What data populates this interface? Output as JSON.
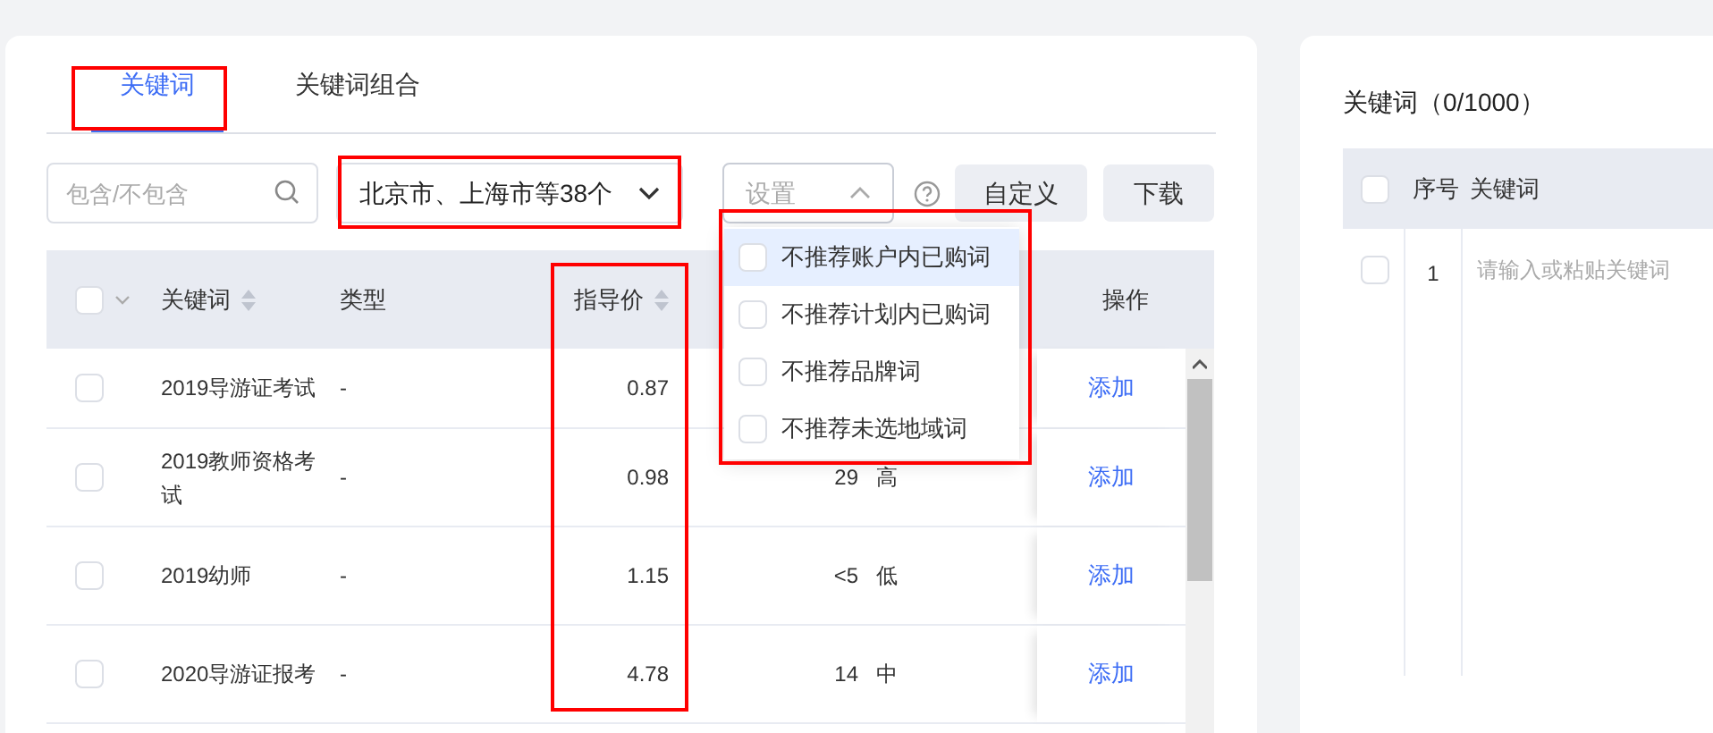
{
  "tabs": [
    {
      "label": "关键词",
      "selected": true,
      "highlighted": true
    },
    {
      "label": "关键词组合",
      "selected": false,
      "highlighted": false
    }
  ],
  "toolbar": {
    "search": {
      "placeholder": "包含/不包含"
    },
    "region_select": {
      "value": "北京市、上海市等38个",
      "highlighted": true
    },
    "settings_select": {
      "placeholder": "设置",
      "expanded": true,
      "highlighted": true,
      "options": [
        {
          "label": "不推荐账户内已购词",
          "checked": false,
          "hovered": true
        },
        {
          "label": "不推荐计划内已购词",
          "checked": false,
          "hovered": false
        },
        {
          "label": "不推荐品牌词",
          "checked": false,
          "hovered": false
        },
        {
          "label": "不推荐未选地域词",
          "checked": false,
          "hovered": false
        }
      ]
    },
    "buttons": [
      "自定义",
      "下载"
    ]
  },
  "table": {
    "select_all_checked": false,
    "header": {
      "keyword": {
        "label": "关键词",
        "sortable": true
      },
      "type": {
        "label": "类型",
        "sortable": false
      },
      "price": {
        "label": "指导价",
        "sortable": true,
        "highlighted": true
      },
      "action": {
        "label": "操作"
      }
    },
    "rows": [
      {
        "checked": false,
        "keyword": "2019导游证考试",
        "type": "-",
        "price": "0.87",
        "action": "添加"
      },
      {
        "checked": false,
        "keyword": "2019教师资格考试",
        "type": "-",
        "price": "0.98",
        "volume": "29",
        "competition": "高",
        "action": "添加"
      },
      {
        "checked": false,
        "keyword": "2019幼师",
        "type": "-",
        "price": "1.15",
        "volume": "<5",
        "competition": "低",
        "action": "添加"
      },
      {
        "checked": false,
        "keyword": "2020导游证报考",
        "type": "-",
        "price": "4.78",
        "volume": "14",
        "competition": "中",
        "action": "添加"
      }
    ]
  },
  "selected_panel": {
    "title": "关键词（0/1000）",
    "select_all_checked": false,
    "columns": [
      "序号",
      "关键词"
    ],
    "rows": [
      {
        "checked": false,
        "index": "1",
        "placeholder": "请输入或粘贴关键词"
      }
    ]
  }
}
